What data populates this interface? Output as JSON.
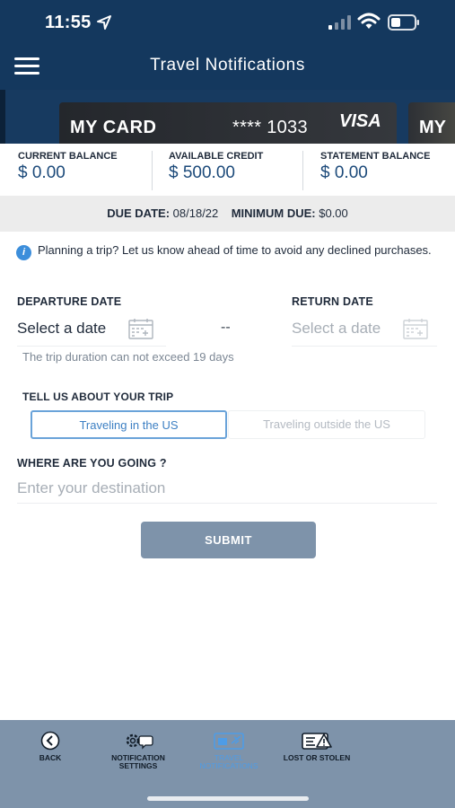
{
  "status_bar": {
    "time": "11:55"
  },
  "header": {
    "title": "Travel Notifications"
  },
  "cards": [
    {
      "name": "MY CARD",
      "number": "**** 1033",
      "brand": "VISA"
    },
    {
      "name": "MY"
    }
  ],
  "balances": [
    {
      "label": "CURRENT BALANCE",
      "value": "$ 0.00"
    },
    {
      "label": "AVAILABLE CREDIT",
      "value": "$ 500.00"
    },
    {
      "label": "STATEMENT BALANCE",
      "value": "$ 0.00"
    }
  ],
  "due": {
    "due_label": "DUE DATE:",
    "due_value": "08/18/22",
    "min_label": "MINIMUM DUE:",
    "min_value": "$0.00"
  },
  "info": {
    "text": "Planning a trip? Let us know ahead of time to avoid any declined purchases."
  },
  "trip_dates": {
    "departure_label": "DEPARTURE DATE",
    "departure_placeholder": "Select a date",
    "return_label": "RETURN DATE",
    "return_placeholder": "Select a date",
    "separator": "--",
    "hint": "The trip duration can not exceed 19 days"
  },
  "trip_type": {
    "label": "TELL US ABOUT YOUR TRIP",
    "options": [
      "Traveling in the US",
      "Traveling outside the US"
    ],
    "selected": "Traveling in the US"
  },
  "destination": {
    "label": "WHERE ARE YOU GOING ?",
    "placeholder": "Enter your destination"
  },
  "submit_label": "SUBMIT",
  "bottom_nav": [
    {
      "label": "BACK",
      "icon": "back-circle-icon"
    },
    {
      "label": "NOTIFICATION\nSETTINGS",
      "icon": "gear-chat-icon"
    },
    {
      "label": "TRAVEL\nNOTIFICATIONS",
      "icon": "card-plane-icon",
      "active": true
    },
    {
      "label": "LOST OR STOLEN",
      "icon": "card-warning-icon"
    }
  ],
  "colors": {
    "header": "#14385e",
    "accent": "#3c7fc3",
    "submit": "#7e93aa",
    "nav": "#7e93aa"
  }
}
